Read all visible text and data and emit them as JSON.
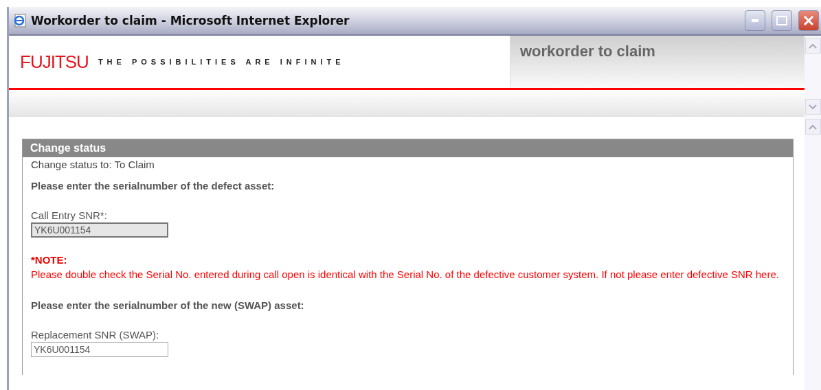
{
  "window": {
    "title": "Workorder to claim - Microsoft Internet Explorer"
  },
  "header": {
    "logo": "FUJITSU",
    "tagline": "THE POSSIBILITIES ARE INFINITE",
    "page_title": "workorder to claim"
  },
  "panel": {
    "title": "Change status",
    "status_line": "Change status to: To Claim",
    "sections": [
      {
        "kind": "heading",
        "text": "Please enter the serialnumber of the defect asset:"
      },
      {
        "kind": "field",
        "label": "Call Entry SNR*:",
        "value": "YK6U001154",
        "disabled": true
      },
      {
        "kind": "note",
        "title": "*NOTE:",
        "text": "Please double check the Serial No. entered during call open is identical with the Serial No. of the defective customer system. If not please enter defective SNR here."
      },
      {
        "kind": "heading",
        "text": "Please enter the serialnumber of the new (SWAP) asset:"
      },
      {
        "kind": "field",
        "label": "Replacement SNR (SWAP):",
        "value": "YK6U001154",
        "disabled": false
      }
    ]
  }
}
